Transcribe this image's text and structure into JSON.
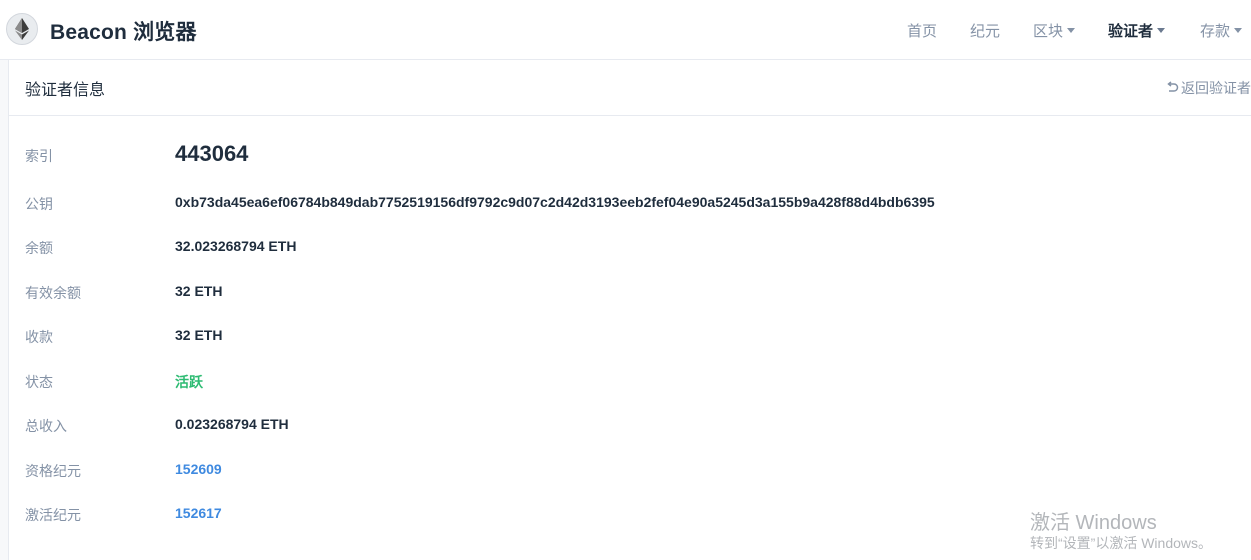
{
  "brand": "Beacon 浏览器",
  "nav": {
    "home": "首页",
    "epochs": "纪元",
    "blocks": "区块",
    "validators": "验证者",
    "deposits": "存款"
  },
  "card": {
    "title": "验证者信息",
    "back_link": "返回验证者"
  },
  "details": {
    "index_label": "索引",
    "index_value": "443064",
    "pubkey_label": "公钥",
    "pubkey_value": "0xb73da45ea6ef06784b849dab7752519156df9792c9d07c2d42d3193eeb2fef04e90a5245d3a155b9a428f88d4bdb6395",
    "balance_label": "余额",
    "balance_value": "32.023268794 ETH",
    "effective_balance_label": "有效余额",
    "effective_balance_value": "32 ETH",
    "deposit_label": "收款",
    "deposit_value": "32 ETH",
    "status_label": "状态",
    "status_value": "活跃",
    "income_label": "总收入",
    "income_value": "0.023268794 ETH",
    "eligibility_epoch_label": "资格纪元",
    "eligibility_epoch_value": "152609",
    "activation_epoch_label": "激活纪元",
    "activation_epoch_value": "152617"
  },
  "colors": {
    "status_active": "#2dbb72",
    "link": "#3f8ae0",
    "muted": "#8492a6",
    "text": "#1f2d3d"
  },
  "watermark": {
    "title": "激活 Windows",
    "subtitle": "转到“设置”以激活 Windows。"
  },
  "icons": {
    "logo": "ethereum-logo-icon",
    "back": "return-arrow-icon",
    "dropdown": "caret-down-icon"
  }
}
